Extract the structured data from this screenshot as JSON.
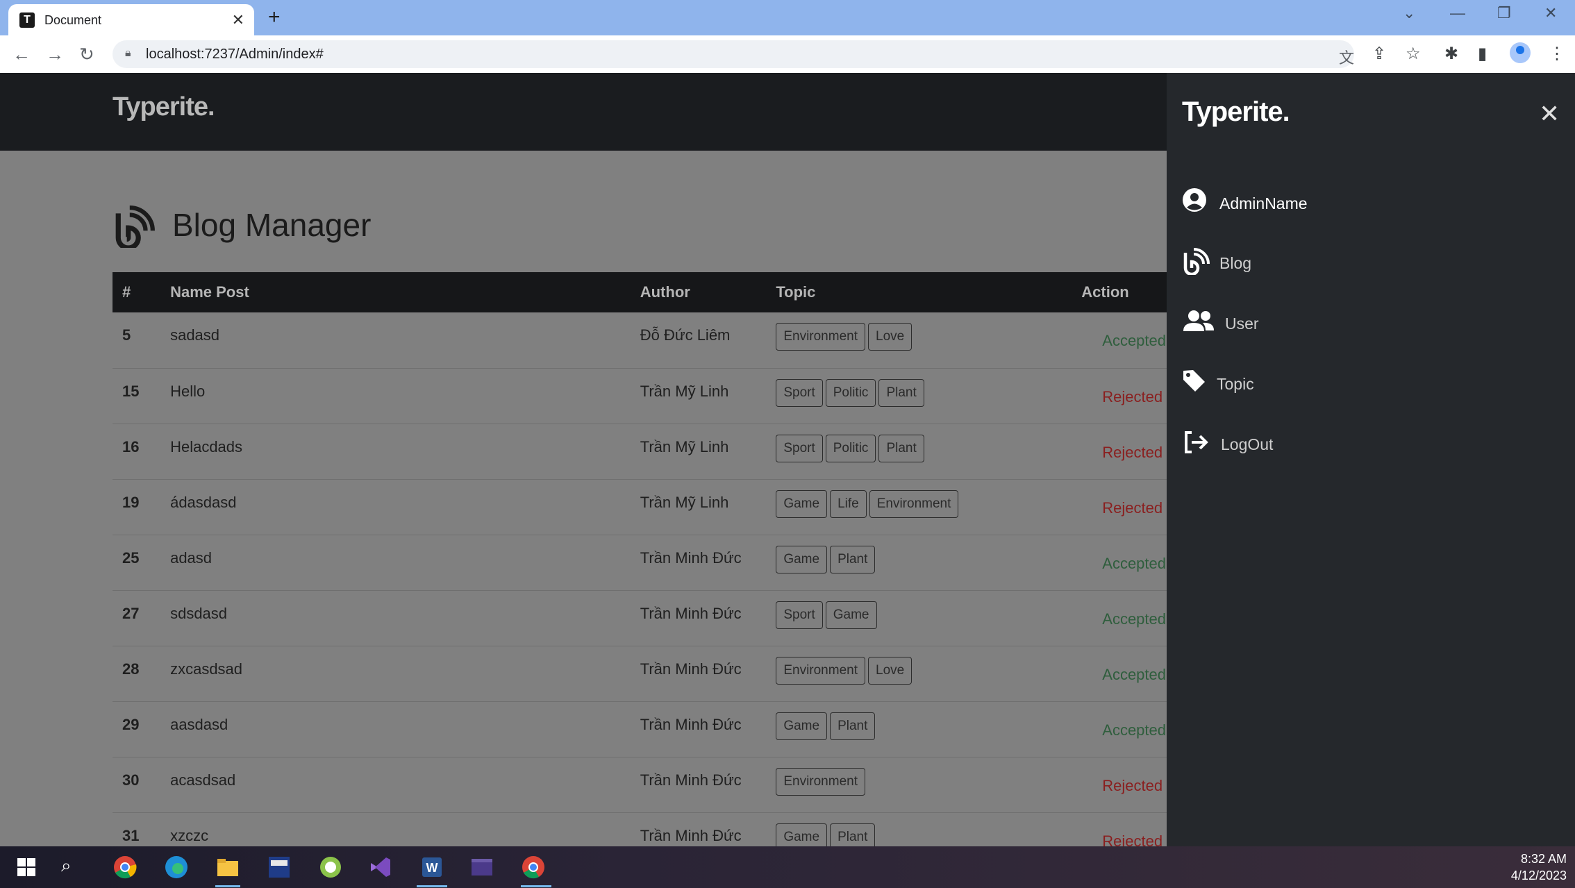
{
  "browser": {
    "tab_title": "Document",
    "url": "localhost:7237/Admin/index#"
  },
  "header": {
    "brand": "Typerite."
  },
  "main": {
    "title": "Blog Manager",
    "columns": [
      "#",
      "Name Post",
      "Author",
      "Topic",
      "Action"
    ],
    "rows": [
      {
        "id": "5",
        "name": "sadasd",
        "author": "Đỗ Đức Liêm",
        "topics": [
          "Environment",
          "Love"
        ],
        "status": "Accepted"
      },
      {
        "id": "15",
        "name": "Hello",
        "author": "Trần Mỹ Linh",
        "topics": [
          "Sport",
          "Politic",
          "Plant"
        ],
        "status": "Rejected"
      },
      {
        "id": "16",
        "name": "Helacdads",
        "author": "Trần Mỹ Linh",
        "topics": [
          "Sport",
          "Politic",
          "Plant"
        ],
        "status": "Rejected"
      },
      {
        "id": "19",
        "name": "ádasdasd",
        "author": "Trần Mỹ Linh",
        "topics": [
          "Game",
          "Life",
          "Environment"
        ],
        "status": "Rejected"
      },
      {
        "id": "25",
        "name": "adasd",
        "author": "Trần Minh Đức",
        "topics": [
          "Game",
          "Plant"
        ],
        "status": "Accepted"
      },
      {
        "id": "27",
        "name": "sdsdasd",
        "author": "Trần Minh Đức",
        "topics": [
          "Sport",
          "Game"
        ],
        "status": "Accepted"
      },
      {
        "id": "28",
        "name": "zxcasdsad",
        "author": "Trần Minh Đức",
        "topics": [
          "Environment",
          "Love"
        ],
        "status": "Accepted"
      },
      {
        "id": "29",
        "name": "aasdasd",
        "author": "Trần Minh Đức",
        "topics": [
          "Game",
          "Plant"
        ],
        "status": "Accepted"
      },
      {
        "id": "30",
        "name": "acasdsad",
        "author": "Trần Minh Đức",
        "topics": [
          "Environment"
        ],
        "status": "Rejected"
      },
      {
        "id": "31",
        "name": "xzczc",
        "author": "Trần Minh Đức",
        "topics": [
          "Game",
          "Plant"
        ],
        "status": "Rejected"
      }
    ]
  },
  "sidebar": {
    "brand": "Typerite.",
    "items": [
      {
        "label": "AdminName",
        "icon": "user-circle-icon"
      },
      {
        "label": "Blog",
        "icon": "blog-icon"
      },
      {
        "label": "User",
        "icon": "users-icon"
      },
      {
        "label": "Topic",
        "icon": "tag-icon"
      },
      {
        "label": "LogOut",
        "icon": "logout-icon"
      }
    ]
  },
  "taskbar": {
    "time": "8:32 AM",
    "date": "4/12/2023"
  },
  "colors": {
    "accepted": "#2f5e3d",
    "rejected": "#8a1f1f",
    "sidebar_bg": "#25282c"
  }
}
